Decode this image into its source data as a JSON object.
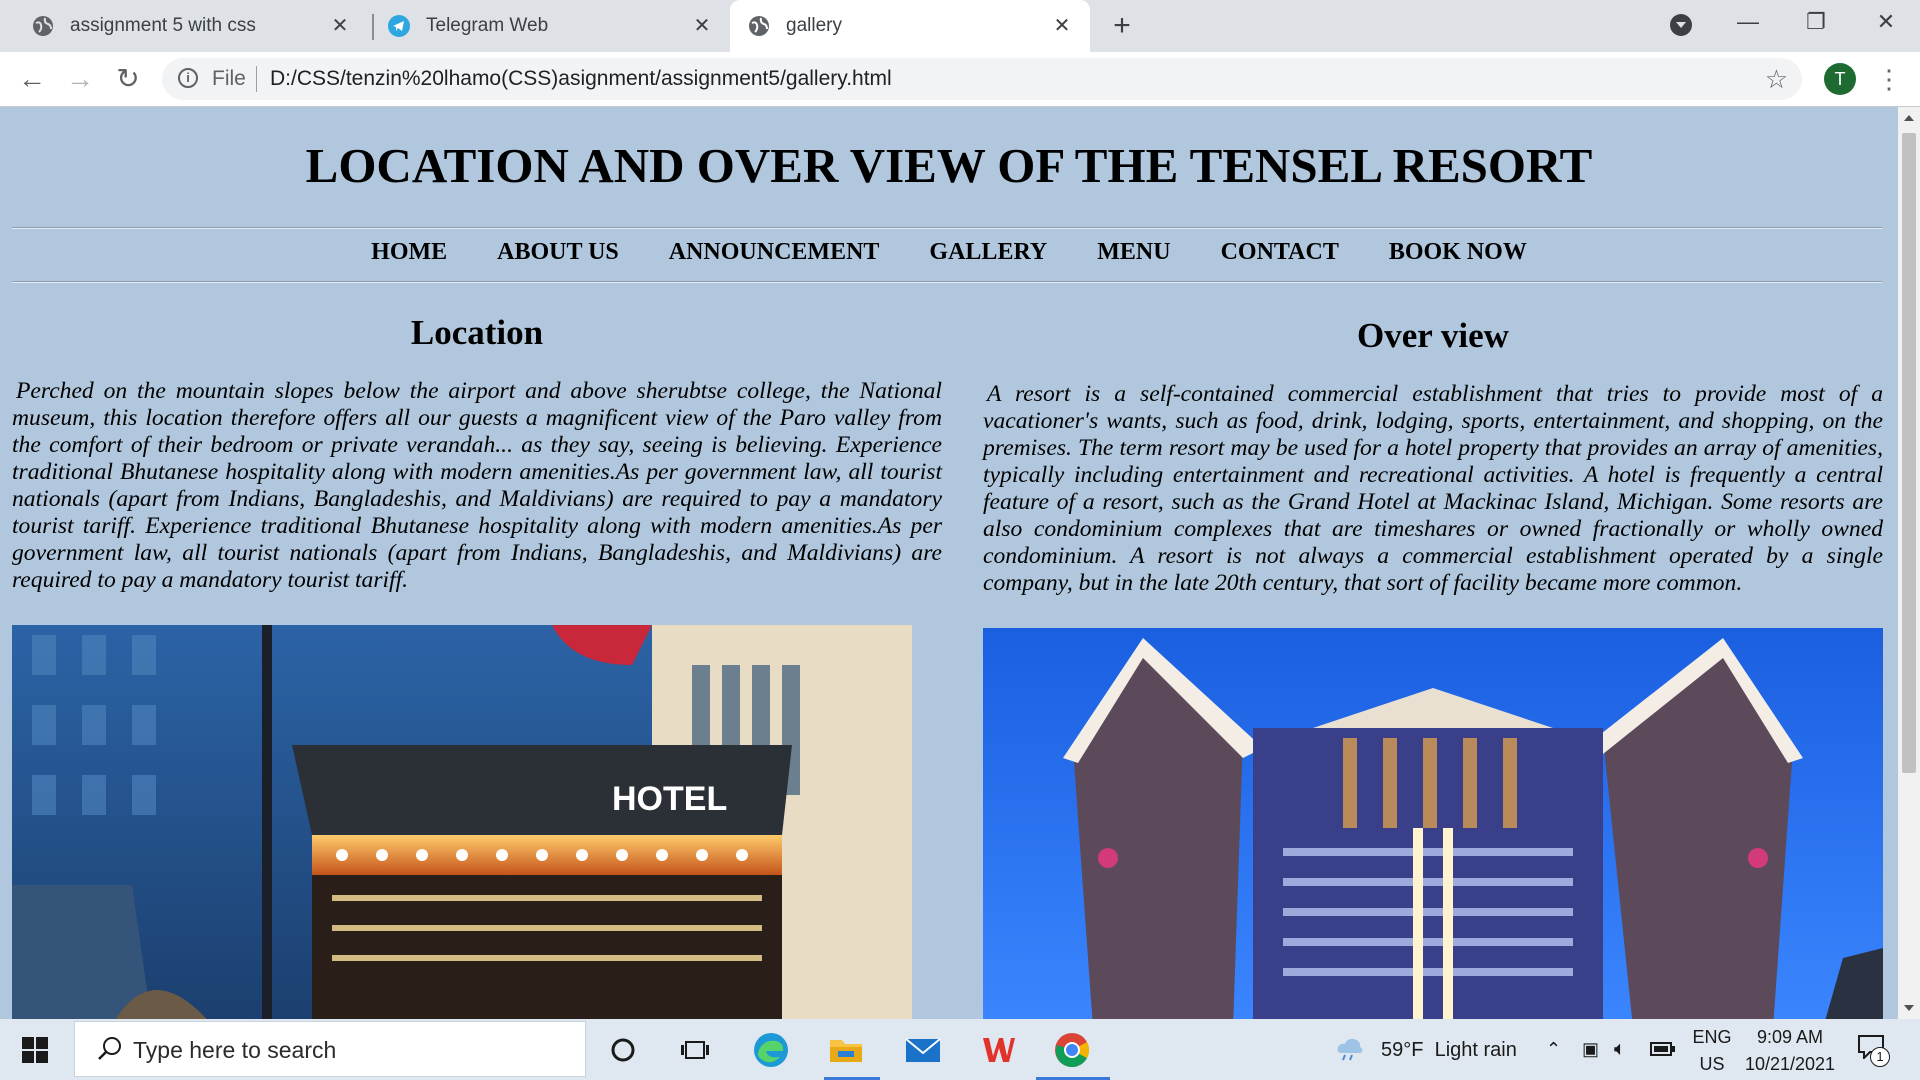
{
  "browser": {
    "tabs": [
      {
        "title": "assignment 5 with css",
        "icon": "globe-icon"
      },
      {
        "title": "Telegram Web",
        "icon": "telegram-icon"
      },
      {
        "title": "gallery",
        "icon": "globe-icon",
        "active": true
      }
    ],
    "new_tab": "+",
    "address": {
      "scheme_label": "File",
      "url": "D:/CSS/tenzin%20lhamo(CSS)asignment/assignment5/gallery.html"
    },
    "profile_initial": "T"
  },
  "page": {
    "title": "LOCATION AND OVER VIEW OF THE TENSEL RESORT",
    "nav": [
      "HOME",
      "ABOUT US",
      "ANNOUNCEMENT",
      "GALLERY",
      "MENU",
      "CONTACT",
      "BOOK NOW"
    ],
    "location": {
      "heading": "Location",
      "text": "Perched on the mountain slopes below the airport and above sherubtse college, the National museum, this location therefore offers all our guests a magnificent view of the Paro valley from the comfort of their bedroom or private verandah... as they say, seeing is believing. Experience traditional Bhutanese hospitality along with modern amenities.As per government law, all tourist nationals (apart from Indians, Bangladeshis, and Maldivians) are required to pay a mandatory tourist tariff. Experience traditional Bhutanese hospitality along with modern amenities.As per government law, all tourist nationals (apart from Indians, Bangladeshis, and Maldivians) are required to pay a mandatory tourist tariff.",
      "image_sign": "HOTEL"
    },
    "overview": {
      "heading": "Over view",
      "text": "A resort is a self-contained commercial establishment that tries to provide most of a vacationer's wants, such as food, drink, lodging, sports, entertainment, and shopping, on the premises. The term resort may be used for a hotel property that provides an array of amenities, typically including entertainment and recreational activities. A hotel is frequently a central feature of a resort, such as the Grand Hotel at Mackinac Island, Michigan. Some resorts are also condominium complexes that are timeshares or owned fractionally or wholly owned condominium. A resort is not always a commercial establishment operated by a single company, but in the late 20th century, that sort of facility became more common."
    }
  },
  "taskbar": {
    "search_placeholder": "Type here to search",
    "weather": "59°F  Light rain",
    "lang_top": "ENG",
    "lang_bottom": "US",
    "time": "9:09 AM",
    "date": "10/21/2021",
    "notifications": "1"
  },
  "colors": {
    "page_bg": "#b0c7dd",
    "tab_bar": "#dee1e6",
    "taskbar": "#dfe8f0",
    "accent": "#3b78d8"
  }
}
